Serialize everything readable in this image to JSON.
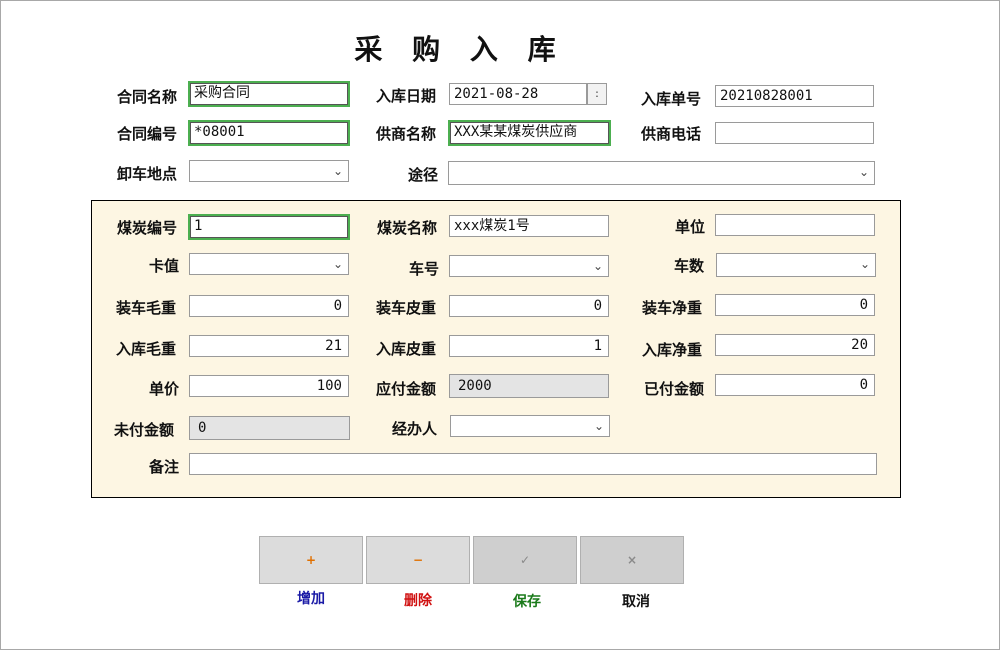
{
  "title": "采 购 入 库",
  "header": {
    "contract_name": {
      "label": "合同名称",
      "value": "采购合同"
    },
    "inbound_date": {
      "label": "入库日期",
      "value": "2021-08-28",
      "spin": ":"
    },
    "inbound_no": {
      "label": "入库单号",
      "value": "20210828001"
    },
    "contract_no": {
      "label": "合同编号",
      "value": "*08001"
    },
    "supplier_name": {
      "label": "供商名称",
      "value": "XXX某某煤炭供应商"
    },
    "supplier_phone": {
      "label": "供商电话",
      "value": ""
    },
    "unload_place": {
      "label": "卸车地点",
      "value": ""
    },
    "route": {
      "label": "途径",
      "value": ""
    }
  },
  "detail": {
    "coal_no": {
      "label": "煤炭编号",
      "value": "1"
    },
    "coal_name": {
      "label": "煤炭名称",
      "value": "xxx煤炭1号"
    },
    "unit": {
      "label": "单位",
      "value": ""
    },
    "card_value": {
      "label": "卡值",
      "value": ""
    },
    "truck_no": {
      "label": "车号",
      "value": ""
    },
    "truck_count": {
      "label": "车数",
      "value": ""
    },
    "load_gross": {
      "label": "装车毛重",
      "value": "0"
    },
    "load_tare": {
      "label": "装车皮重",
      "value": "0"
    },
    "load_net": {
      "label": "装车净重",
      "value": "0"
    },
    "in_gross": {
      "label": "入库毛重",
      "value": "21"
    },
    "in_tare": {
      "label": "入库皮重",
      "value": "1"
    },
    "in_net": {
      "label": "入库净重",
      "value": "20"
    },
    "unit_price": {
      "label": "单价",
      "value": "100"
    },
    "payable": {
      "label": "应付金额",
      "value": "2000"
    },
    "paid": {
      "label": "已付金额",
      "value": "0"
    },
    "unpaid": {
      "label": "未付金额",
      "value": "0"
    },
    "handler": {
      "label": "经办人",
      "value": ""
    },
    "remark": {
      "label": "备注",
      "value": ""
    }
  },
  "buttons": {
    "add": {
      "icon": "+",
      "label": "增加",
      "color": "#1a1aa6",
      "icon_color": "#e07000"
    },
    "delete": {
      "icon": "−",
      "label": "删除",
      "color": "#d01010",
      "icon_color": "#e07000"
    },
    "save": {
      "icon": "✓",
      "label": "保存",
      "color": "#1a7a1a",
      "icon_color": "#8a8a8a"
    },
    "cancel": {
      "icon": "×",
      "label": "取消",
      "color": "#111111",
      "icon_color": "#8a8a8a"
    }
  }
}
